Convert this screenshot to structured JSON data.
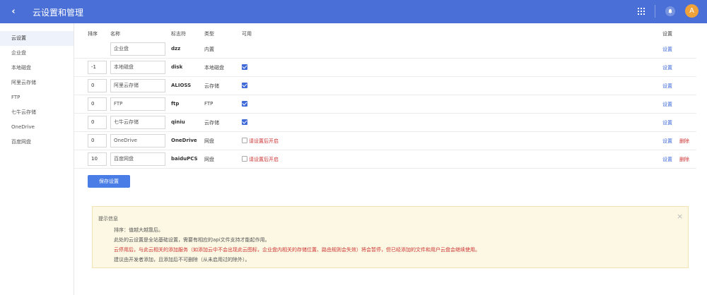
{
  "header": {
    "back_icon": "chevron-left-icon",
    "title": "云设置和管理",
    "avatar_letter": "A",
    "accent_color": "#4a6fd6"
  },
  "sidebar": {
    "items": [
      {
        "label": "云设置",
        "active": true
      },
      {
        "label": "企业盘",
        "active": false
      },
      {
        "label": "本地磁盘",
        "active": false
      },
      {
        "label": "阿里云存储",
        "active": false
      },
      {
        "label": "FTP",
        "active": false
      },
      {
        "label": "七牛云存储",
        "active": false
      },
      {
        "label": "OneDrive",
        "active": false
      },
      {
        "label": "百度网盘",
        "active": false
      }
    ]
  },
  "table": {
    "headers": {
      "order": "排序",
      "name": "名称",
      "ident": "标志符",
      "type": "类型",
      "enable": "可用",
      "settings": "设置"
    },
    "rows": [
      {
        "order": "",
        "name": "企业盘",
        "ident": "dzz",
        "type": "内置",
        "enabled": null,
        "enable_hint": "",
        "set_label": "设置",
        "del_label": ""
      },
      {
        "order": "-1",
        "name": "本地磁盘",
        "ident": "disk",
        "type": "本地磁盘",
        "enabled": true,
        "enable_hint": "",
        "set_label": "设置",
        "del_label": ""
      },
      {
        "order": "0",
        "name": "阿里云存储",
        "ident": "ALIOSS",
        "type": "云存储",
        "enabled": true,
        "enable_hint": "",
        "set_label": "设置",
        "del_label": ""
      },
      {
        "order": "0",
        "name": "FTP",
        "ident": "ftp",
        "type": "FTP",
        "enabled": true,
        "enable_hint": "",
        "set_label": "设置",
        "del_label": ""
      },
      {
        "order": "0",
        "name": "七牛云存储",
        "ident": "qiniu",
        "type": "云存储",
        "enabled": true,
        "enable_hint": "",
        "set_label": "设置",
        "del_label": ""
      },
      {
        "order": "0",
        "name": "OneDrive",
        "ident": "OneDrive",
        "type": "网盘",
        "enabled": false,
        "enable_hint": "请设置后开启",
        "set_label": "设置",
        "del_label": "删除"
      },
      {
        "order": "10",
        "name": "百度网盘",
        "ident": "baiduPCS",
        "type": "网盘",
        "enabled": false,
        "enable_hint": "请设置后开启",
        "set_label": "设置",
        "del_label": "删除"
      }
    ]
  },
  "save_button": "保存设置",
  "tips": {
    "title": "提示信息",
    "lines": [
      {
        "text": "排序：值越大越靠后。",
        "red": false
      },
      {
        "text": "此处的云设置是全站基础设置，需要有相应的api文件支持才能起作用。",
        "red": false
      },
      {
        "text": "云停用后，与此云相关的添加服务（如添加云中不会出现此云图标，企业盘内相关的存储位置、路由规则会失效）将会暂停，但已经添加的文件和用户云盘会继续使用。",
        "red": true
      },
      {
        "text": "建议由开发者添加，且添加后不可删除（从未启用过的除外）。",
        "red": false
      }
    ]
  }
}
